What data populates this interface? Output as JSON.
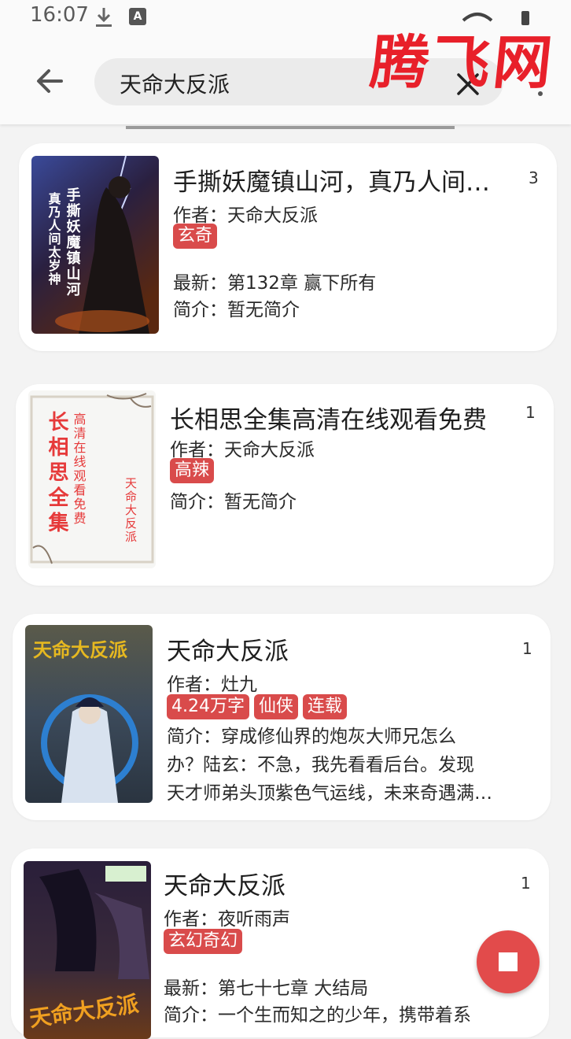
{
  "status": {
    "time": "16:07",
    "a_badge": "A"
  },
  "search": {
    "query": "天命大反派"
  },
  "watermark": "腾飞网",
  "results": [
    {
      "title": "手撕妖魔镇山河，真乃人间太岁神",
      "count": "3",
      "author": "作者：天命大反派",
      "tags": [
        "玄奇"
      ],
      "latest": "最新：第132章 赢下所有",
      "intro": "简介：暂无简介",
      "cover_text": "手撕妖魔镇山河 真乃人间太岁神"
    },
    {
      "title": "长相思全集高清在线观看免费",
      "count": "1",
      "author": "作者：天命大反派",
      "tags": [
        "高辣"
      ],
      "intro": "简介：暂无简介",
      "cover_big": "长相思全集",
      "cover_small": "高清在线观看免费",
      "cover_author": "天命大反派"
    },
    {
      "title": "天命大反派",
      "count": "1",
      "author": "作者：灶九",
      "tags": [
        "4.24万字",
        "仙侠",
        "连载"
      ],
      "intro_lines": [
        "简介：穿成修仙界的炮灰大师兄怎么",
        "办？陆玄：不急，我先看看后台。发现",
        "天才师弟头顶紫色气运线，未来奇遇满…"
      ],
      "cover_text": "天命大反派"
    },
    {
      "title": "天命大反派",
      "count": "1",
      "author": "作者：夜听雨声",
      "tags": [
        "玄幻奇幻"
      ],
      "latest": "最新：第七十七章 大结局",
      "intro": "简介：一个生而知之的少年，携带着系",
      "cover_text": "天命大反派"
    }
  ]
}
